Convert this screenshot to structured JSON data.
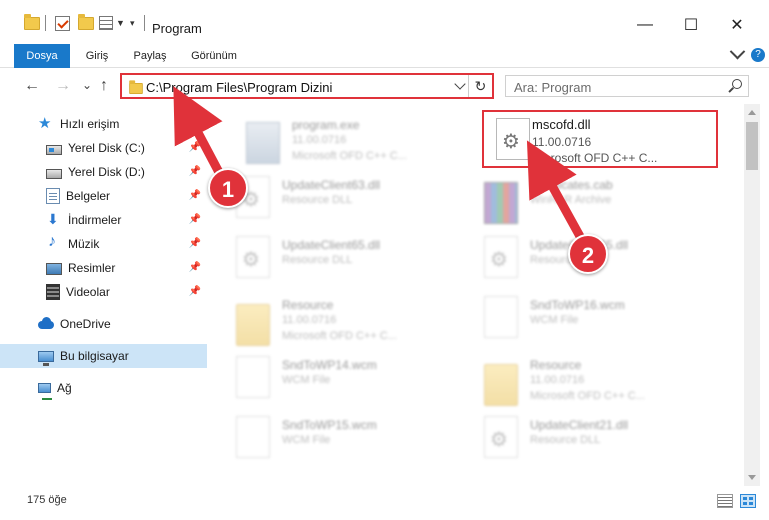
{
  "window": {
    "title": "Program",
    "minimize": "—",
    "maximize": "☐",
    "close": "✕"
  },
  "ribbon": {
    "tabs": [
      {
        "label": "Dosya"
      },
      {
        "label": "Giriş"
      },
      {
        "label": "Paylaş"
      },
      {
        "label": "Görünüm"
      }
    ],
    "help": "?"
  },
  "nav": {
    "back": "←",
    "forward": "→",
    "recent": "⌄",
    "up": "↑",
    "address": "C:\\Program Files\\Program Dizini",
    "refresh": "↻",
    "search_placeholder": "Ara: Program"
  },
  "sidebar": {
    "items": [
      {
        "label": "Hızlı erişim",
        "icon": "star-icon"
      },
      {
        "label": "Yerel Disk (C:)",
        "icon": "drive-icon",
        "pinned": true
      },
      {
        "label": "Yerel Disk (D:)",
        "icon": "drive-icon",
        "pinned": true
      },
      {
        "label": "Belgeler",
        "icon": "documents-icon",
        "pinned": true
      },
      {
        "label": "İndirmeler",
        "icon": "download-icon",
        "pinned": true
      },
      {
        "label": "Müzik",
        "icon": "music-icon",
        "pinned": true
      },
      {
        "label": "Resimler",
        "icon": "pictures-icon",
        "pinned": true
      },
      {
        "label": "Videolar",
        "icon": "videos-icon",
        "pinned": true
      },
      {
        "label": "OneDrive",
        "icon": "cloud-icon"
      },
      {
        "label": "Bu bilgisayar",
        "icon": "computer-icon",
        "selected": true
      },
      {
        "label": "Ağ",
        "icon": "network-icon"
      }
    ],
    "pin_glyph": "📌"
  },
  "files": [
    {
      "name": "program.exe",
      "line2": "11.00.0716",
      "line3": "Microsoft OFD C++ C...",
      "icon": "exe-icon"
    },
    {
      "name": "mscofd.dll",
      "line2": "11.00.0716",
      "line3": "Microsoft OFD C++ C...",
      "icon": "dll-icon"
    },
    {
      "name": "UpdateClient63.dll",
      "line2": "Resource DLL",
      "line3": "",
      "icon": "dll-icon"
    },
    {
      "name": "Certificates.cab",
      "line2": "WinRAR Archive",
      "line3": "",
      "icon": "archive-icon"
    },
    {
      "name": "UpdateClient65.dll",
      "line2": "Resource DLL",
      "line3": "",
      "icon": "dll-icon"
    },
    {
      "name": "UpdateClient65.dll",
      "line2": "Resource DLL",
      "line3": "",
      "icon": "dll-icon"
    },
    {
      "name": "Resource",
      "line2": "11.00.0716",
      "line3": "Microsoft OFD C++ C...",
      "icon": "folder-icon"
    },
    {
      "name": "SndToWP16.wcm",
      "line2": "WCM File",
      "line3": "",
      "icon": "file-icon"
    },
    {
      "name": "SndToWP14.wcm",
      "line2": "WCM File",
      "line3": "",
      "icon": "file-icon"
    },
    {
      "name": "Resource",
      "line2": "11.00.0716",
      "line3": "Microsoft OFD C++ C...",
      "icon": "folder-icon"
    },
    {
      "name": "SndToWP15.wcm",
      "line2": "WCM File",
      "line3": "",
      "icon": "file-icon"
    },
    {
      "name": "UpdateClient21.dll",
      "line2": "Resource DLL",
      "line3": "",
      "icon": "dll-icon"
    }
  ],
  "status": {
    "item_count": "175 öğe"
  },
  "annotations": {
    "badge1": "1",
    "badge2": "2"
  },
  "colors": {
    "accent": "#1979ca",
    "highlight": "#e0323a",
    "selection": "#cce4f7"
  }
}
